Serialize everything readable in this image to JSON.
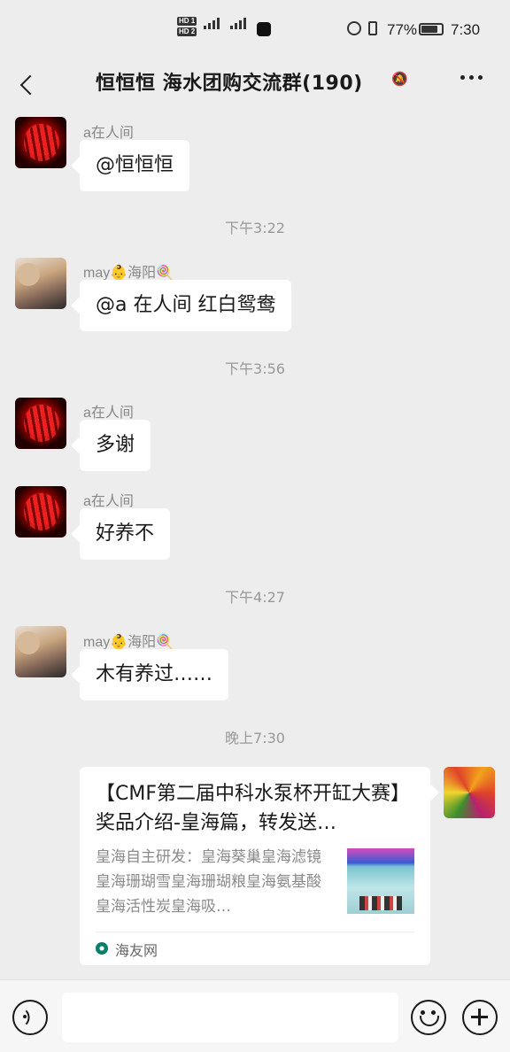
{
  "status_bar": {
    "hd1": "HD 1",
    "hd2": "HD 2",
    "net1": "4G",
    "net2": "4G",
    "battery": "77%",
    "time": "7:30"
  },
  "header": {
    "title": "恒恒恒  海水团购交流群(190)",
    "mute_icon": "bell-off-icon",
    "more_icon": "more-icon"
  },
  "messages": [
    {
      "sender": "a在人间",
      "text": "@恒恒恒"
    },
    {
      "timestamp": "下午3:22"
    },
    {
      "sender": "may👶海阳🍭",
      "text": "@a 在人间  红白鸳鸯"
    },
    {
      "timestamp": "下午3:56"
    },
    {
      "sender": "a在人间",
      "text": "多谢"
    },
    {
      "sender": "a在人间",
      "text": "好养不"
    },
    {
      "timestamp": "下午4:27"
    },
    {
      "sender": "may👶海阳🍭",
      "text": "木有养过……"
    },
    {
      "timestamp": "晚上7:30"
    }
  ],
  "link_card": {
    "title": "【CMF第二届中科水泵杯开缸大赛】奖品介绍-皇海篇，转发送…",
    "description": "皇海自主研发：皇海葵巢皇海滤镜皇海珊瑚雪皇海珊瑚粮皇海氨基酸皇海活性炭皇海吸…",
    "source": "海友网"
  },
  "input_bar": {
    "voice_icon": "voice-icon",
    "emoji_icon": "emoji-icon",
    "plus_icon": "plus-icon",
    "input_value": ""
  }
}
